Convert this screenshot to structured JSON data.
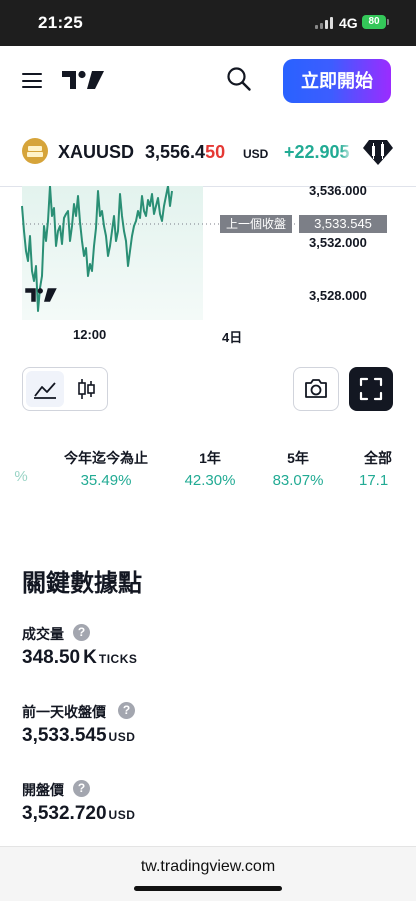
{
  "status_bar": {
    "time": "21:25",
    "network": "4G",
    "battery": "80"
  },
  "header": {
    "cta_label": "立即開始"
  },
  "symbol": {
    "ticker": "XAUUSD",
    "price_main": "3,556.4",
    "price_tail": "50",
    "currency": "USD",
    "change": "+22.905"
  },
  "chart": {
    "y_ticks": [
      "3,536.000",
      "3,532.000",
      "3,528.000"
    ],
    "prev_close_label": "上一個收盤",
    "prev_close_value": "3,533.545",
    "x_ticks": [
      "12:00",
      "4日"
    ]
  },
  "performance": [
    {
      "label": "",
      "value": "%"
    },
    {
      "label": "今年迄今為止",
      "value": "35.49%"
    },
    {
      "label": "1年",
      "value": "42.30%"
    },
    {
      "label": "5年",
      "value": "83.07%"
    },
    {
      "label": "全部",
      "value": "17.1"
    }
  ],
  "key_stats": {
    "title": "關鍵數據點",
    "items": [
      {
        "label": "成交量",
        "value": "348.50",
        "value_suffix": "K",
        "unit": "TICKS"
      },
      {
        "label": "前一天收盤價",
        "value": "3,533.545",
        "value_suffix": "",
        "unit": "USD"
      },
      {
        "label": "開盤價",
        "value": "3,532.720",
        "value_suffix": "",
        "unit": "USD"
      }
    ]
  },
  "browser": {
    "url": "tw.tradingview.com"
  },
  "colors": {
    "up": "#22ab94",
    "down": "#e53935",
    "accent": "#2962ff"
  }
}
